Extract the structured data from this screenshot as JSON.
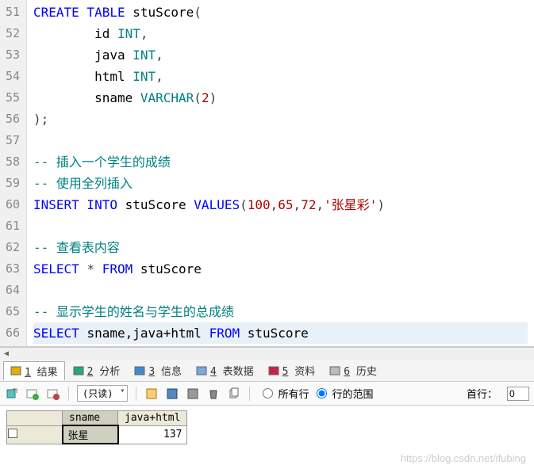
{
  "code": {
    "line_start": 51,
    "lines": [
      {
        "n": 51,
        "tokens": [
          {
            "t": "CREATE TABLE ",
            "c": "kw"
          },
          {
            "t": "stuScore",
            "c": "ident"
          },
          {
            "t": "(",
            "c": "punct"
          }
        ]
      },
      {
        "n": 52,
        "tokens": [
          {
            "t": "        id ",
            "c": "ident"
          },
          {
            "t": "INT",
            "c": "type"
          },
          {
            "t": ",",
            "c": "punct"
          }
        ]
      },
      {
        "n": 53,
        "tokens": [
          {
            "t": "        java ",
            "c": "ident"
          },
          {
            "t": "INT",
            "c": "type"
          },
          {
            "t": ",",
            "c": "punct"
          }
        ]
      },
      {
        "n": 54,
        "tokens": [
          {
            "t": "        html ",
            "c": "ident"
          },
          {
            "t": "INT",
            "c": "type"
          },
          {
            "t": ",",
            "c": "punct"
          }
        ]
      },
      {
        "n": 55,
        "tokens": [
          {
            "t": "        sname ",
            "c": "ident"
          },
          {
            "t": "VARCHAR",
            "c": "type"
          },
          {
            "t": "(",
            "c": "punct"
          },
          {
            "t": "2",
            "c": "num"
          },
          {
            "t": ")",
            "c": "punct"
          }
        ]
      },
      {
        "n": 56,
        "tokens": [
          {
            "t": ");",
            "c": "punct"
          }
        ]
      },
      {
        "n": 57,
        "tokens": []
      },
      {
        "n": 58,
        "tokens": [
          {
            "t": "-- 插入一个学生的成绩",
            "c": "cmt"
          }
        ]
      },
      {
        "n": 59,
        "tokens": [
          {
            "t": "-- 使用全列插入",
            "c": "cmt"
          }
        ]
      },
      {
        "n": 60,
        "tokens": [
          {
            "t": "INSERT INTO ",
            "c": "kw"
          },
          {
            "t": "stuScore ",
            "c": "ident"
          },
          {
            "t": "VALUES",
            "c": "kw"
          },
          {
            "t": "(",
            "c": "punct"
          },
          {
            "t": "100",
            "c": "num"
          },
          {
            "t": ",",
            "c": "punct"
          },
          {
            "t": "65",
            "c": "num"
          },
          {
            "t": ",",
            "c": "punct"
          },
          {
            "t": "72",
            "c": "num"
          },
          {
            "t": ",",
            "c": "punct"
          },
          {
            "t": "'张星彩'",
            "c": "str"
          },
          {
            "t": ")",
            "c": "punct"
          }
        ]
      },
      {
        "n": 61,
        "tokens": []
      },
      {
        "n": 62,
        "tokens": [
          {
            "t": "-- 查看表内容",
            "c": "cmt"
          }
        ]
      },
      {
        "n": 63,
        "tokens": [
          {
            "t": "SELECT ",
            "c": "kw"
          },
          {
            "t": "* ",
            "c": "punct"
          },
          {
            "t": "FROM ",
            "c": "kw"
          },
          {
            "t": "stuScore",
            "c": "ident"
          }
        ]
      },
      {
        "n": 64,
        "tokens": []
      },
      {
        "n": 65,
        "tokens": [
          {
            "t": "-- 显示学生的姓名与学生的总成绩",
            "c": "cmt"
          }
        ]
      },
      {
        "n": 66,
        "tokens": [
          {
            "t": "SELECT ",
            "c": "kw"
          },
          {
            "t": "sname,java+html ",
            "c": "ident"
          },
          {
            "t": "FROM ",
            "c": "kw"
          },
          {
            "t": "stuScore",
            "c": "ident"
          }
        ],
        "current": true
      }
    ]
  },
  "tabs": {
    "items": [
      {
        "num": "1",
        "label": "结果",
        "icon": "#e0b000",
        "active": true
      },
      {
        "num": "2",
        "label": "分析",
        "icon": "#2a7",
        "active": false
      },
      {
        "num": "3",
        "label": "信息",
        "icon": "#48c",
        "active": false
      },
      {
        "num": "4",
        "label": "表数据",
        "icon": "#7ad",
        "active": false
      },
      {
        "num": "5",
        "label": "资料",
        "icon": "#c24",
        "active": false
      },
      {
        "num": "6",
        "label": "历史",
        "icon": "#bbb",
        "active": false
      }
    ]
  },
  "toolbar": {
    "readonly_label": "(只读)",
    "radio_all": "所有行",
    "radio_range": "行的范围",
    "firstrow_label": "首行：",
    "firstrow_value": "0"
  },
  "result": {
    "columns": [
      "sname",
      "java+html"
    ],
    "rows": [
      {
        "sname": "张星",
        "sum": "137"
      }
    ]
  },
  "watermark": "https://blog.csdn.net/ifubing"
}
